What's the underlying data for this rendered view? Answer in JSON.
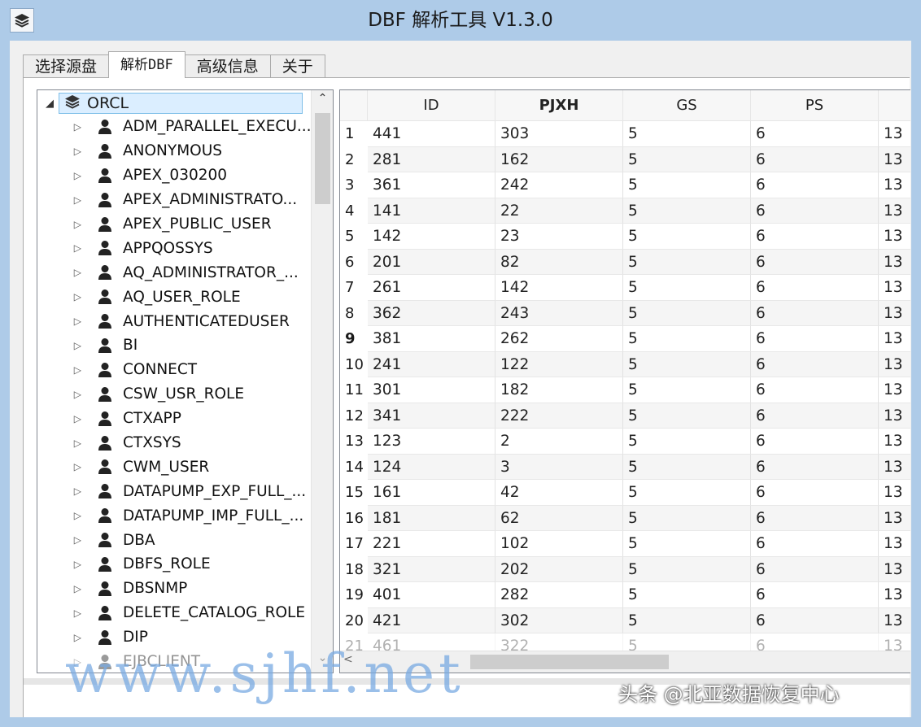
{
  "window": {
    "title": "DBF 解析工具  V1.3.0"
  },
  "tabs": [
    {
      "label": "选择源盘",
      "active": false
    },
    {
      "label": "解析DBF",
      "active": true
    },
    {
      "label": "高级信息",
      "active": false
    },
    {
      "label": "关于",
      "active": false
    }
  ],
  "tree": {
    "root": {
      "label": "ORCL",
      "icon": "layers-icon",
      "expanded": true
    },
    "items": [
      "ADM_PARALLEL_EXECU...",
      "ANONYMOUS",
      "APEX_030200",
      "APEX_ADMINISTRATO...",
      "APEX_PUBLIC_USER",
      "APPQOSSYS",
      "AQ_ADMINISTRATOR_...",
      "AQ_USER_ROLE",
      "AUTHENTICATEDUSER",
      "BI",
      "CONNECT",
      "CSW_USR_ROLE",
      "CTXAPP",
      "CTXSYS",
      "CWM_USER",
      "DATAPUMP_EXP_FULL_...",
      "DATAPUMP_IMP_FULL_...",
      "DBA",
      "DBFS_ROLE",
      "DBSNMP",
      "DELETE_CATALOG_ROLE",
      "DIP",
      "EJBCLIENT"
    ]
  },
  "grid": {
    "columns": [
      "ID",
      "PJXH",
      "GS",
      "PS",
      ""
    ],
    "selected_row": 9,
    "rows": [
      [
        "1",
        "441",
        "303",
        "5",
        "6",
        "13"
      ],
      [
        "2",
        "281",
        "162",
        "5",
        "6",
        "13"
      ],
      [
        "3",
        "361",
        "242",
        "5",
        "6",
        "13"
      ],
      [
        "4",
        "141",
        "22",
        "5",
        "6",
        "13"
      ],
      [
        "5",
        "142",
        "23",
        "5",
        "6",
        "13"
      ],
      [
        "6",
        "201",
        "82",
        "5",
        "6",
        "13"
      ],
      [
        "7",
        "261",
        "142",
        "5",
        "6",
        "13"
      ],
      [
        "8",
        "362",
        "243",
        "5",
        "6",
        "13"
      ],
      [
        "9",
        "381",
        "262",
        "5",
        "6",
        "13"
      ],
      [
        "10",
        "241",
        "122",
        "5",
        "6",
        "13"
      ],
      [
        "11",
        "301",
        "182",
        "5",
        "6",
        "13"
      ],
      [
        "12",
        "341",
        "222",
        "5",
        "6",
        "13"
      ],
      [
        "13",
        "123",
        "2",
        "5",
        "6",
        "13"
      ],
      [
        "14",
        "124",
        "3",
        "5",
        "6",
        "13"
      ],
      [
        "15",
        "161",
        "42",
        "5",
        "6",
        "13"
      ],
      [
        "16",
        "181",
        "62",
        "5",
        "6",
        "13"
      ],
      [
        "17",
        "221",
        "102",
        "5",
        "6",
        "13"
      ],
      [
        "18",
        "321",
        "202",
        "5",
        "6",
        "13"
      ],
      [
        "19",
        "401",
        "282",
        "5",
        "6",
        "13"
      ],
      [
        "20",
        "421",
        "302",
        "5",
        "6",
        "13"
      ],
      [
        "21",
        "461",
        "322",
        "5",
        "6",
        "13"
      ]
    ]
  },
  "overlay": {
    "watermark": "www.sjhf.net",
    "caption": "头条 @北亚数据恢复中心"
  }
}
